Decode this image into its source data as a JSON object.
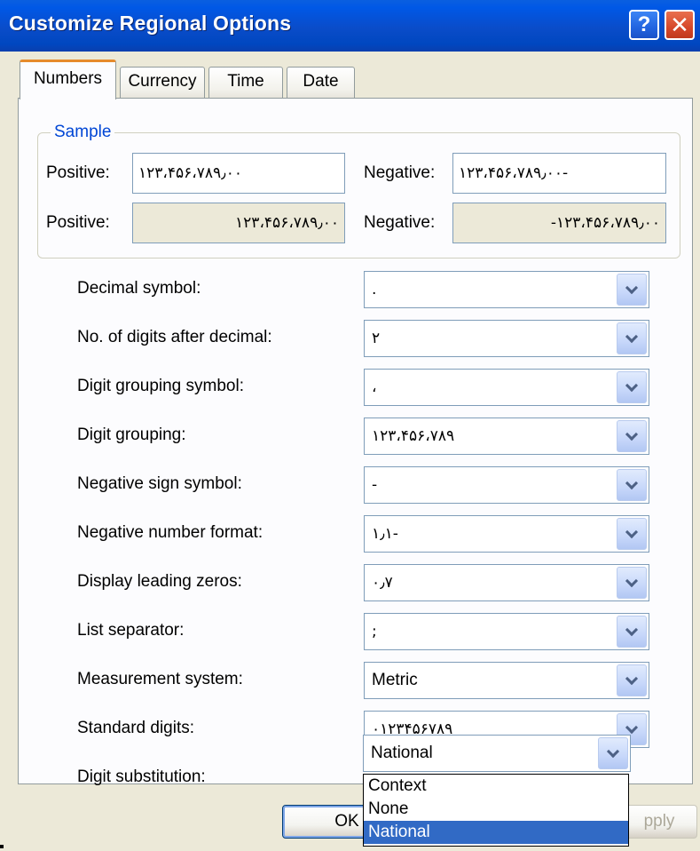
{
  "window": {
    "title": "Customize Regional Options",
    "help_glyph": "?",
    "close_glyph": "✕"
  },
  "tabs": [
    {
      "label": "Numbers",
      "active": true
    },
    {
      "label": "Currency",
      "active": false
    },
    {
      "label": "Time",
      "active": false
    },
    {
      "label": "Date",
      "active": false
    }
  ],
  "sample": {
    "legend": "Sample",
    "positive_label": "Positive:",
    "negative_label": "Negative:",
    "positive_value_1": "۱۲۳،۴۵۶،۷۸۹٫۰۰",
    "negative_value_1": "۱۲۳،۴۵۶،۷۸۹٫۰۰-",
    "positive_value_2": "۱۲۳،۴۵۶،۷۸۹٫۰۰",
    "negative_value_2": "-۱۲۳،۴۵۶،۷۸۹٫۰۰"
  },
  "settings": [
    {
      "label": "Decimal symbol:",
      "value": "."
    },
    {
      "label": "No. of digits after decimal:",
      "value": "۲"
    },
    {
      "label": "Digit grouping symbol:",
      "value": "،"
    },
    {
      "label": "Digit grouping:",
      "value": "۱۲۳،۴۵۶،۷۸۹"
    },
    {
      "label": "Negative sign symbol:",
      "value": "-"
    },
    {
      "label": "Negative number format:",
      "value": "۱٫۱-"
    },
    {
      "label": "Display leading zeros:",
      "value": "۰٫۷"
    },
    {
      "label": "List separator:",
      "value": ";"
    },
    {
      "label": "Measurement system:",
      "value": "Metric"
    },
    {
      "label": "Standard digits:",
      "value": "۰۱۲۳۴۵۶۷۸۹"
    },
    {
      "label": "Digit substitution:",
      "value": "National"
    }
  ],
  "dropdown_options": [
    "Context",
    "None",
    "National"
  ],
  "dropdown_selected": "National",
  "buttons": {
    "ok": "OK",
    "apply": "pply"
  },
  "colors": {
    "title_bar": "#0A4CC9",
    "legend_text": "#0046D5",
    "selection": "#316AC5",
    "active_tab_accent": "#E68B2C"
  }
}
